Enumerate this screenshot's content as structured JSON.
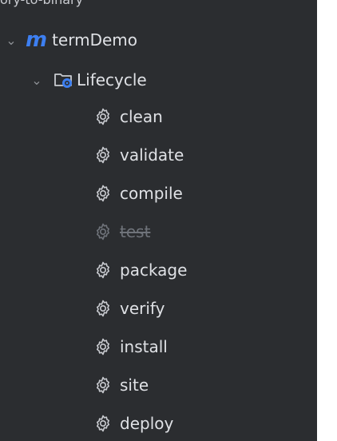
{
  "top_partial_text": "ory-to-binary",
  "project": {
    "label": "termDemo",
    "logo_text": "m",
    "icon": "maven-logo-icon",
    "toggle_icon": "chevron-down-icon"
  },
  "lifecycle": {
    "label": "Lifecycle",
    "icon": "folder-gear-icon",
    "toggle_icon": "chevron-down-icon"
  },
  "goals": [
    {
      "label": "clean",
      "icon": "gear-icon",
      "disabled": false
    },
    {
      "label": "validate",
      "icon": "gear-icon",
      "disabled": false
    },
    {
      "label": "compile",
      "icon": "gear-icon",
      "disabled": false
    },
    {
      "label": "test",
      "icon": "gear-icon",
      "disabled": true
    },
    {
      "label": "package",
      "icon": "gear-icon",
      "disabled": false
    },
    {
      "label": "verify",
      "icon": "gear-icon",
      "disabled": false
    },
    {
      "label": "install",
      "icon": "gear-icon",
      "disabled": false
    },
    {
      "label": "site",
      "icon": "gear-icon",
      "disabled": false
    },
    {
      "label": "deploy",
      "icon": "gear-icon",
      "disabled": false
    }
  ],
  "colors": {
    "panel_bg": "#2b2d30",
    "text": "#dfe1e5",
    "muted": "#6f737a",
    "accent": "#3d7ff1"
  }
}
